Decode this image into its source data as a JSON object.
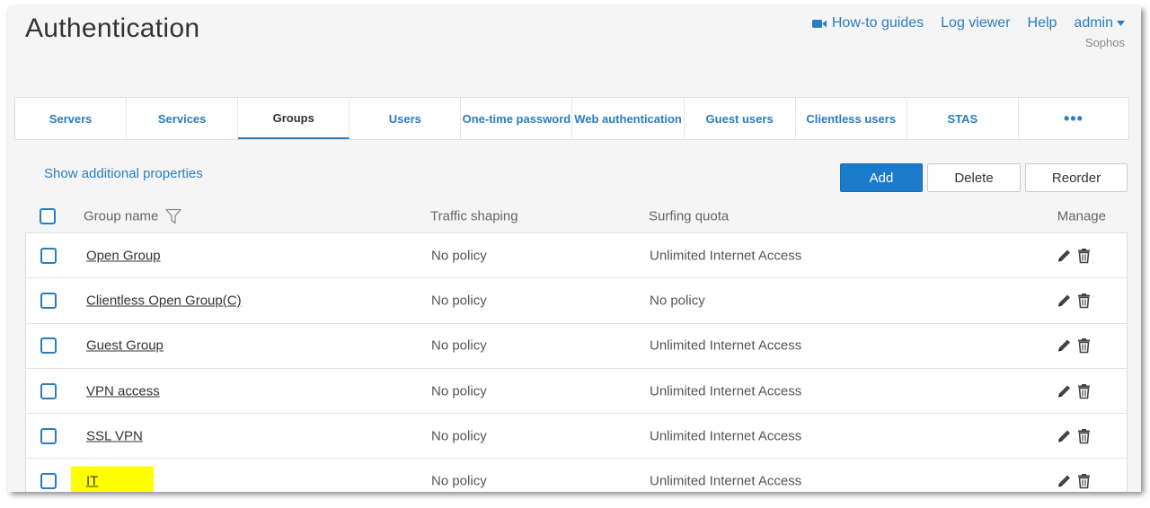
{
  "header": {
    "title": "Authentication",
    "links": {
      "howto": "How-to guides",
      "log_viewer": "Log viewer",
      "help": "Help",
      "admin": "admin"
    },
    "org": "Sophos"
  },
  "tabs": [
    {
      "label": "Servers",
      "active": false
    },
    {
      "label": "Services",
      "active": false
    },
    {
      "label": "Groups",
      "active": true
    },
    {
      "label": "Users",
      "active": false
    },
    {
      "label": "One-time password",
      "active": false
    },
    {
      "label": "Web authentication",
      "active": false
    },
    {
      "label": "Guest users",
      "active": false
    },
    {
      "label": "Clientless users",
      "active": false
    },
    {
      "label": "STAS",
      "active": false
    },
    {
      "label": "•••",
      "active": false
    }
  ],
  "toolbar": {
    "show_properties": "Show additional properties",
    "add": "Add",
    "delete": "Delete",
    "reorder": "Reorder"
  },
  "table": {
    "headers": {
      "name": "Group name",
      "traffic": "Traffic shaping",
      "surfing": "Surfing quota",
      "manage": "Manage"
    },
    "rows": [
      {
        "name": "Open Group",
        "traffic": "No policy",
        "surfing": "Unlimited Internet Access",
        "highlighted": false
      },
      {
        "name": "Clientless Open Group(C)",
        "traffic": "No policy",
        "surfing": "No policy",
        "highlighted": false
      },
      {
        "name": "Guest Group",
        "traffic": "No policy",
        "surfing": "Unlimited Internet Access",
        "highlighted": false
      },
      {
        "name": "VPN access",
        "traffic": "No policy",
        "surfing": "Unlimited Internet Access",
        "highlighted": false
      },
      {
        "name": "SSL VPN",
        "traffic": "No policy",
        "surfing": "Unlimited Internet Access",
        "highlighted": false
      },
      {
        "name": "IT",
        "traffic": "No policy",
        "surfing": "Unlimited Internet Access",
        "highlighted": true
      }
    ]
  },
  "colors": {
    "accent": "#2a7dc0",
    "primary_button": "#1b7ccc",
    "highlight": "#ffff00"
  }
}
